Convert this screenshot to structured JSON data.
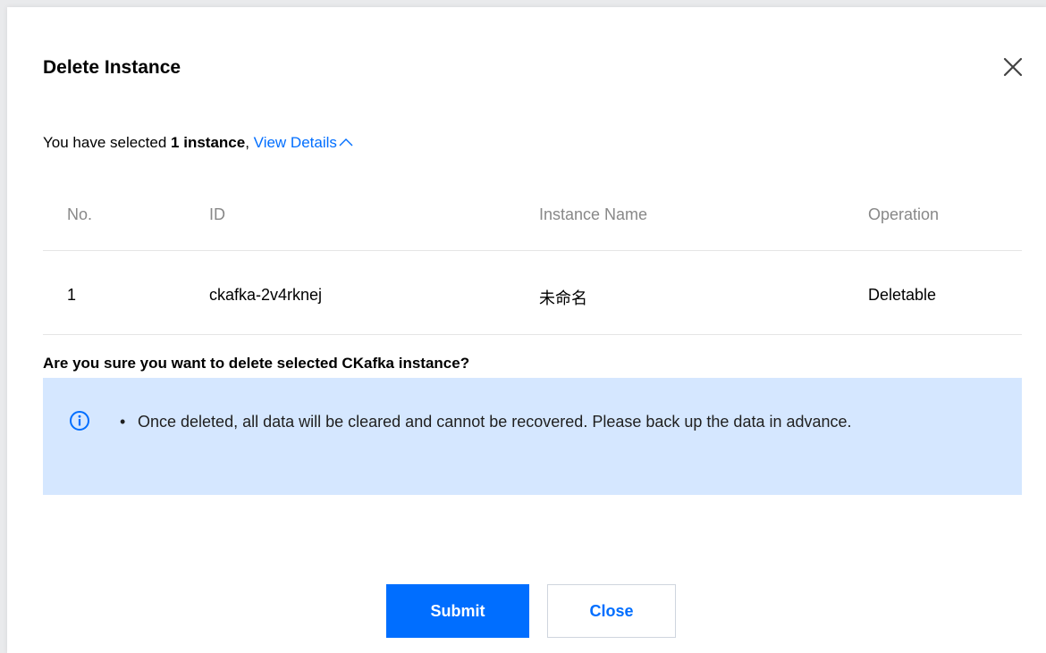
{
  "dialog": {
    "title": "Delete Instance",
    "close_icon": "close-icon"
  },
  "summary": {
    "prefix": "You have selected ",
    "count": "1 instance",
    "comma": ", ",
    "link": "View Details",
    "link_icon": "chevron-up-icon"
  },
  "table": {
    "headers": [
      "No.",
      "ID",
      "Instance Name",
      "Operation"
    ],
    "rows": [
      {
        "no": "1",
        "id": "ckafka-2v4rknej",
        "name": "未命名",
        "operation": "Deletable"
      }
    ]
  },
  "confirm_text": "Are you sure you want to delete selected CKafka instance?",
  "notice": {
    "icon": "info-icon",
    "bullet": "•",
    "text": "Once deleted, all data will be cleared and cannot be recovered. Please back up the data in advance."
  },
  "buttons": {
    "submit": "Submit",
    "close": "Close"
  },
  "colors": {
    "accent": "#006eff",
    "notice_bg": "#d5e7ff"
  }
}
